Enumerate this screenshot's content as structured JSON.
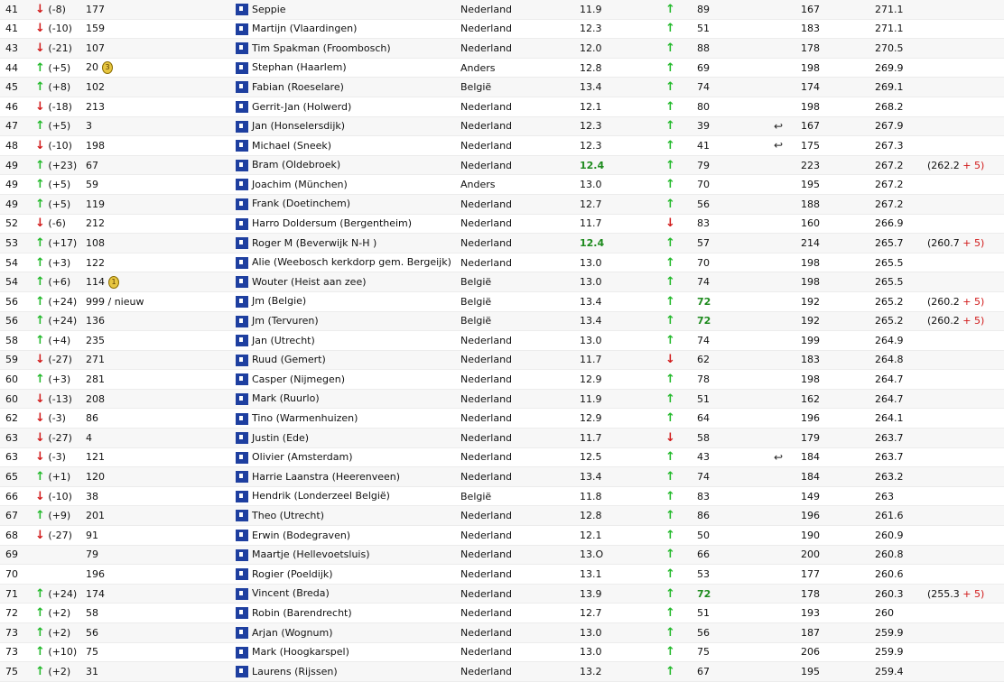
{
  "rows": [
    {
      "rank": "41",
      "dir": "down",
      "delta": "(-8)",
      "prev": "177",
      "name": "Seppie",
      "country": "Nederland",
      "score": "11.9",
      "scoreGreen": false,
      "trend": "up",
      "t2": "89",
      "t2Green": false,
      "ret": false,
      "a": "167",
      "total": "271.1",
      "extra": ""
    },
    {
      "rank": "41",
      "dir": "down",
      "delta": "(-10)",
      "prev": "159",
      "name": "Martijn (Vlaardingen)",
      "country": "Nederland",
      "score": "12.3",
      "scoreGreen": false,
      "trend": "up",
      "t2": "51",
      "t2Green": false,
      "ret": false,
      "a": "183",
      "total": "271.1",
      "extra": ""
    },
    {
      "rank": "43",
      "dir": "down",
      "delta": "(-21)",
      "prev": "107",
      "name": "Tim Spakman (Froombosch)",
      "country": "Nederland",
      "score": "12.0",
      "scoreGreen": false,
      "trend": "up",
      "t2": "88",
      "t2Green": false,
      "ret": false,
      "a": "178",
      "total": "270.5",
      "extra": ""
    },
    {
      "rank": "44",
      "dir": "up",
      "delta": "(+5)",
      "prev": "20",
      "medal": "3",
      "name": "Stephan (Haarlem)",
      "country": "Anders",
      "score": "12.8",
      "scoreGreen": false,
      "trend": "up",
      "t2": "69",
      "t2Green": false,
      "ret": false,
      "a": "198",
      "total": "269.9",
      "extra": ""
    },
    {
      "rank": "45",
      "dir": "up",
      "delta": "(+8)",
      "prev": "102",
      "name": "Fabian (Roeselare)",
      "country": "België",
      "score": "13.4",
      "scoreGreen": false,
      "trend": "up",
      "t2": "74",
      "t2Green": false,
      "ret": false,
      "a": "174",
      "total": "269.1",
      "extra": ""
    },
    {
      "rank": "46",
      "dir": "down",
      "delta": "(-18)",
      "prev": "213",
      "name": "Gerrit-Jan (Holwerd)",
      "country": "Nederland",
      "score": "12.1",
      "scoreGreen": false,
      "trend": "up",
      "t2": "80",
      "t2Green": false,
      "ret": false,
      "a": "198",
      "total": "268.2",
      "extra": ""
    },
    {
      "rank": "47",
      "dir": "up",
      "delta": "(+5)",
      "prev": "3",
      "name": "Jan (Honselersdijk)",
      "country": "Nederland",
      "score": "12.3",
      "scoreGreen": false,
      "trend": "up",
      "t2": "39",
      "t2Green": false,
      "ret": true,
      "a": "167",
      "total": "267.9",
      "extra": ""
    },
    {
      "rank": "48",
      "dir": "down",
      "delta": "(-10)",
      "prev": "198",
      "name": "Michael (Sneek)",
      "country": "Nederland",
      "score": "12.3",
      "scoreGreen": false,
      "trend": "up",
      "t2": "41",
      "t2Green": false,
      "ret": true,
      "a": "175",
      "total": "267.3",
      "extra": ""
    },
    {
      "rank": "49",
      "dir": "up",
      "delta": "(+23)",
      "prev": "67",
      "name": "Bram (Oldebroek)",
      "country": "Nederland",
      "score": "12.4",
      "scoreGreen": true,
      "trend": "up",
      "t2": "79",
      "t2Green": false,
      "ret": false,
      "a": "223",
      "total": "267.2",
      "extra": "(262.2",
      "extraPlus": "+ 5)"
    },
    {
      "rank": "49",
      "dir": "up",
      "delta": "(+5)",
      "prev": "59",
      "name": "Joachim (München)",
      "country": "Anders",
      "score": "13.0",
      "scoreGreen": false,
      "trend": "up",
      "t2": "70",
      "t2Green": false,
      "ret": false,
      "a": "195",
      "total": "267.2",
      "extra": ""
    },
    {
      "rank": "49",
      "dir": "up",
      "delta": "(+5)",
      "prev": "119",
      "name": "Frank (Doetinchem)",
      "country": "Nederland",
      "score": "12.7",
      "scoreGreen": false,
      "trend": "up",
      "t2": "56",
      "t2Green": false,
      "ret": false,
      "a": "188",
      "total": "267.2",
      "extra": ""
    },
    {
      "rank": "52",
      "dir": "down",
      "delta": "(-6)",
      "prev": "212",
      "name": "Harro Doldersum (Bergentheim)",
      "country": "Nederland",
      "score": "11.7",
      "scoreGreen": false,
      "trend": "down",
      "t2": "83",
      "t2Green": false,
      "ret": false,
      "a": "160",
      "total": "266.9",
      "extra": ""
    },
    {
      "rank": "53",
      "dir": "up",
      "delta": "(+17)",
      "prev": "108",
      "name": "Roger M (Beverwijk N-H )",
      "country": "Nederland",
      "score": "12.4",
      "scoreGreen": true,
      "trend": "up",
      "t2": "57",
      "t2Green": false,
      "ret": false,
      "a": "214",
      "total": "265.7",
      "extra": "(260.7",
      "extraPlus": "+ 5)"
    },
    {
      "rank": "54",
      "dir": "up",
      "delta": "(+3)",
      "prev": "122",
      "name": "Alie (Weebosch kerkdorp gem. Bergeijk)",
      "country": "Nederland",
      "score": "13.0",
      "scoreGreen": false,
      "trend": "up",
      "t2": "70",
      "t2Green": false,
      "ret": false,
      "a": "198",
      "total": "265.5",
      "extra": ""
    },
    {
      "rank": "54",
      "dir": "up",
      "delta": "(+6)",
      "prev": "114",
      "medal": "1",
      "name": "Wouter (Heist aan zee)",
      "country": "België",
      "score": "13.0",
      "scoreGreen": false,
      "trend": "up",
      "t2": "74",
      "t2Green": false,
      "ret": false,
      "a": "198",
      "total": "265.5",
      "extra": ""
    },
    {
      "rank": "56",
      "dir": "up",
      "delta": "(+24)",
      "prev": "999 / nieuw",
      "name": "Jm (Belgie)",
      "country": "België",
      "score": "13.4",
      "scoreGreen": false,
      "trend": "up",
      "t2": "72",
      "t2Green": true,
      "ret": false,
      "a": "192",
      "total": "265.2",
      "extra": "(260.2",
      "extraPlus": "+ 5)"
    },
    {
      "rank": "56",
      "dir": "up",
      "delta": "(+24)",
      "prev": "136",
      "name": "Jm (Tervuren)",
      "country": "België",
      "score": "13.4",
      "scoreGreen": false,
      "trend": "up",
      "t2": "72",
      "t2Green": true,
      "ret": false,
      "a": "192",
      "total": "265.2",
      "extra": "(260.2",
      "extraPlus": "+ 5)"
    },
    {
      "rank": "58",
      "dir": "up",
      "delta": "(+4)",
      "prev": "235",
      "name": "Jan (Utrecht)",
      "country": "Nederland",
      "score": "13.0",
      "scoreGreen": false,
      "trend": "up",
      "t2": "74",
      "t2Green": false,
      "ret": false,
      "a": "199",
      "total": "264.9",
      "extra": ""
    },
    {
      "rank": "59",
      "dir": "down",
      "delta": "(-27)",
      "prev": "271",
      "name": "Ruud (Gemert)",
      "country": "Nederland",
      "score": "11.7",
      "scoreGreen": false,
      "trend": "down",
      "t2": "62",
      "t2Green": false,
      "ret": false,
      "a": "183",
      "total": "264.8",
      "extra": ""
    },
    {
      "rank": "60",
      "dir": "up",
      "delta": "(+3)",
      "prev": "281",
      "name": "Casper (Nijmegen)",
      "country": "Nederland",
      "score": "12.9",
      "scoreGreen": false,
      "trend": "up",
      "t2": "78",
      "t2Green": false,
      "ret": false,
      "a": "198",
      "total": "264.7",
      "extra": ""
    },
    {
      "rank": "60",
      "dir": "down",
      "delta": "(-13)",
      "prev": "208",
      "name": "Mark (Ruurlo)",
      "country": "Nederland",
      "score": "11.9",
      "scoreGreen": false,
      "trend": "up",
      "t2": "51",
      "t2Green": false,
      "ret": false,
      "a": "162",
      "total": "264.7",
      "extra": ""
    },
    {
      "rank": "62",
      "dir": "down",
      "delta": "(-3)",
      "prev": "86",
      "name": "Tino (Warmenhuizen)",
      "country": "Nederland",
      "score": "12.9",
      "scoreGreen": false,
      "trend": "up",
      "t2": "64",
      "t2Green": false,
      "ret": false,
      "a": "196",
      "total": "264.1",
      "extra": ""
    },
    {
      "rank": "63",
      "dir": "down",
      "delta": "(-27)",
      "prev": "4",
      "name": "Justin (Ede)",
      "country": "Nederland",
      "score": "11.7",
      "scoreGreen": false,
      "trend": "down",
      "t2": "58",
      "t2Green": false,
      "ret": false,
      "a": "179",
      "total": "263.7",
      "extra": ""
    },
    {
      "rank": "63",
      "dir": "down",
      "delta": "(-3)",
      "prev": "121",
      "name": "Olivier (Amsterdam)",
      "country": "Nederland",
      "score": "12.5",
      "scoreGreen": false,
      "trend": "up",
      "t2": "43",
      "t2Green": false,
      "ret": true,
      "a": "184",
      "total": "263.7",
      "extra": ""
    },
    {
      "rank": "65",
      "dir": "up",
      "delta": "(+1)",
      "prev": "120",
      "name": "Harrie Laanstra (Heerenveen)",
      "country": "Nederland",
      "score": "13.4",
      "scoreGreen": false,
      "trend": "up",
      "t2": "74",
      "t2Green": false,
      "ret": false,
      "a": "184",
      "total": "263.2",
      "extra": ""
    },
    {
      "rank": "66",
      "dir": "down",
      "delta": "(-10)",
      "prev": "38",
      "name": "Hendrik (Londerzeel België)",
      "country": "België",
      "score": "11.8",
      "scoreGreen": false,
      "trend": "up",
      "t2": "83",
      "t2Green": false,
      "ret": false,
      "a": "149",
      "total": "263",
      "extra": ""
    },
    {
      "rank": "67",
      "dir": "up",
      "delta": "(+9)",
      "prev": "201",
      "name": "Theo (Utrecht)",
      "country": "Nederland",
      "score": "12.8",
      "scoreGreen": false,
      "trend": "up",
      "t2": "86",
      "t2Green": false,
      "ret": false,
      "a": "196",
      "total": "261.6",
      "extra": ""
    },
    {
      "rank": "68",
      "dir": "down",
      "delta": "(-27)",
      "prev": "91",
      "name": "Erwin (Bodegraven)",
      "country": "Nederland",
      "score": "12.1",
      "scoreGreen": false,
      "trend": "up",
      "t2": "50",
      "t2Green": false,
      "ret": false,
      "a": "190",
      "total": "260.9",
      "extra": ""
    },
    {
      "rank": "69",
      "dir": "",
      "delta": "",
      "prev": "79",
      "name": "Maartje (Hellevoetsluis)",
      "country": "Nederland",
      "score": "13.O",
      "scoreGreen": false,
      "trend": "up",
      "t2": "66",
      "t2Green": false,
      "ret": false,
      "a": "200",
      "total": "260.8",
      "extra": ""
    },
    {
      "rank": "70",
      "dir": "",
      "delta": "",
      "prev": "196",
      "name": "Rogier (Poeldijk)",
      "country": "Nederland",
      "score": "13.1",
      "scoreGreen": false,
      "trend": "up",
      "t2": "53",
      "t2Green": false,
      "ret": false,
      "a": "177",
      "total": "260.6",
      "extra": ""
    },
    {
      "rank": "71",
      "dir": "up",
      "delta": "(+24)",
      "prev": "174",
      "name": "Vincent (Breda)",
      "country": "Nederland",
      "score": "13.9",
      "scoreGreen": false,
      "trend": "up",
      "t2": "72",
      "t2Green": true,
      "ret": false,
      "a": "178",
      "total": "260.3",
      "extra": "(255.3",
      "extraPlus": "+ 5)"
    },
    {
      "rank": "72",
      "dir": "up",
      "delta": "(+2)",
      "prev": "58",
      "name": "Robin (Barendrecht)",
      "country": "Nederland",
      "score": "12.7",
      "scoreGreen": false,
      "trend": "up",
      "t2": "51",
      "t2Green": false,
      "ret": false,
      "a": "193",
      "total": "260",
      "extra": ""
    },
    {
      "rank": "73",
      "dir": "up",
      "delta": "(+2)",
      "prev": "56",
      "name": "Arjan (Wognum)",
      "country": "Nederland",
      "score": "13.0",
      "scoreGreen": false,
      "trend": "up",
      "t2": "56",
      "t2Green": false,
      "ret": false,
      "a": "187",
      "total": "259.9",
      "extra": ""
    },
    {
      "rank": "73",
      "dir": "up",
      "delta": "(+10)",
      "prev": "75",
      "name": "Mark (Hoogkarspel)",
      "country": "Nederland",
      "score": "13.0",
      "scoreGreen": false,
      "trend": "up",
      "t2": "75",
      "t2Green": false,
      "ret": false,
      "a": "206",
      "total": "259.9",
      "extra": ""
    },
    {
      "rank": "75",
      "dir": "up",
      "delta": "(+2)",
      "prev": "31",
      "name": "Laurens (Rijssen)",
      "country": "Nederland",
      "score": "13.2",
      "scoreGreen": false,
      "trend": "up",
      "t2": "67",
      "t2Green": false,
      "ret": false,
      "a": "195",
      "total": "259.4",
      "extra": ""
    }
  ],
  "colors": {
    "up": "#22b92a",
    "down": "#d11a1a",
    "green": "#1e8b1e"
  }
}
